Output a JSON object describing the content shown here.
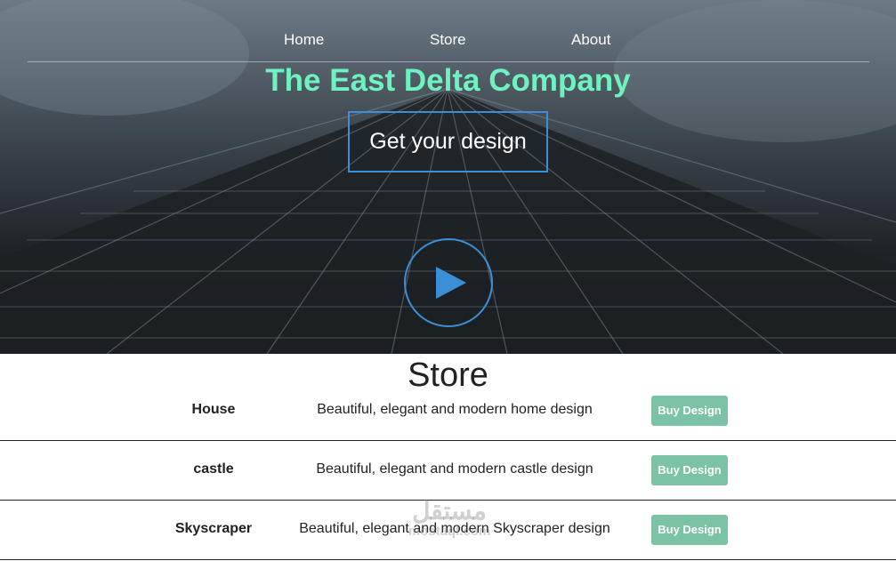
{
  "nav": {
    "items": [
      "Home",
      "Store",
      "About"
    ]
  },
  "hero": {
    "title": "The East Delta Company",
    "cta_label": "Get your design"
  },
  "store": {
    "heading": "Store",
    "buy_label": "Buy Design",
    "rows": [
      {
        "name": "House",
        "description": "Beautiful, elegant and modern home design"
      },
      {
        "name": "castle",
        "description": "Beautiful, elegant and modern castle design"
      },
      {
        "name": "Skyscraper",
        "description": "Beautiful, elegant and modern Skyscraper design"
      }
    ]
  },
  "watermark": {
    "arabic": "مستقل",
    "latin": "mostaql.com"
  },
  "colors": {
    "title": "#6ff2c1",
    "accent": "#3a8fd6",
    "button": "#7cc3a6"
  }
}
